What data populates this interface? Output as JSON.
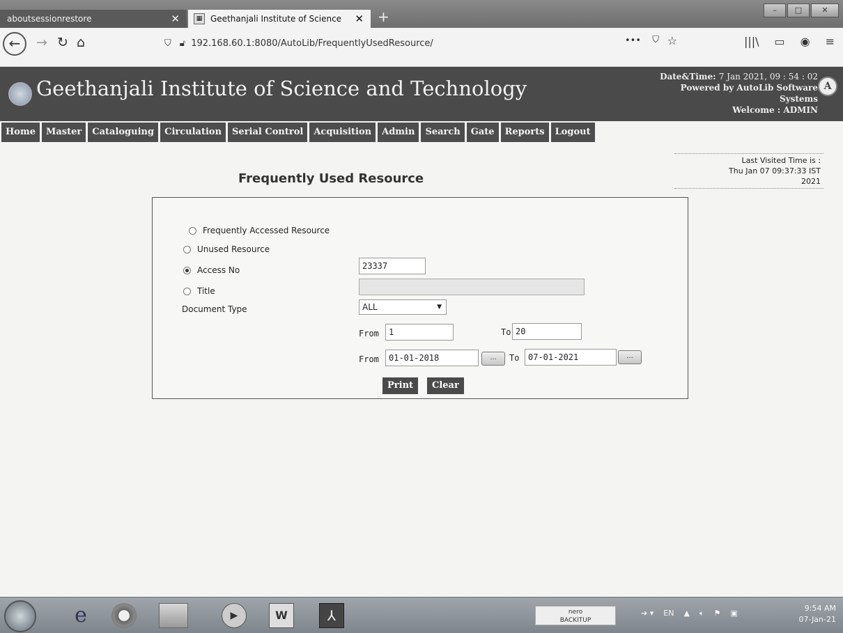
{
  "browser": {
    "tabs": [
      {
        "label": "aboutsessionrestore",
        "active": false
      },
      {
        "label": "Geethanjali Institute of Science",
        "active": true
      }
    ],
    "new_tab_label": "+",
    "url": "192.168.60.1:8080/AutoLib/FrequentlyUsedResource/",
    "window_controls": {
      "minimize": "–",
      "maximize": "□",
      "close": "✕"
    }
  },
  "header": {
    "institute_name": "Geethanjali Institute of Science and Technology",
    "datetime_label": "Date&Time:",
    "datetime_value": "7 Jan 2021, 09 : 54 : 02",
    "powered_by_line1": "Powered by AutoLib Software",
    "powered_by_line2": "Systems",
    "welcome_label": "Welcome",
    "welcome_sep": ":",
    "welcome_user": "ADMIN",
    "brand_logo_text": "A"
  },
  "menu": [
    "Home",
    "Master",
    "Cataloguing",
    "Circulation",
    "Serial Control",
    "Acquisition",
    "Admin",
    "Search",
    "Gate",
    "Reports",
    "Logout"
  ],
  "last_visited": {
    "line1": "Last Visited Time is :",
    "line2": "Thu Jan 07 09:37:33 IST",
    "line3": "2021"
  },
  "page_title": "Frequently Used Resource",
  "form": {
    "options": {
      "frequently_accessed": "Frequently Accessed Resource",
      "unused": "Unused Resource",
      "access_no": "Access No",
      "title": "Title"
    },
    "selected_option": "access_no",
    "access_no_value": "23337",
    "title_value": "",
    "document_type_label": "Document Type",
    "document_type_value": "ALL",
    "range_from_label": "From",
    "range_from_value": "1",
    "range_to_label": "To",
    "range_to_value": "20",
    "date_from_label": "From",
    "date_from_value": "01-01-2018",
    "date_to_label": "To",
    "date_to_value": "07-01-2021",
    "cal_button_label": "...",
    "print_label": "Print",
    "clear_label": "Clear"
  },
  "taskbar": {
    "nero_line1": "nero",
    "nero_line2": "BACKITUP",
    "tray_lang": "EN",
    "time": "9:54 AM",
    "date": "07-Jan-21"
  },
  "colors": {
    "header_bg": "#4a4a4a",
    "menu_bg": "#4d4d4d",
    "page_bg": "#f4f4f2"
  }
}
